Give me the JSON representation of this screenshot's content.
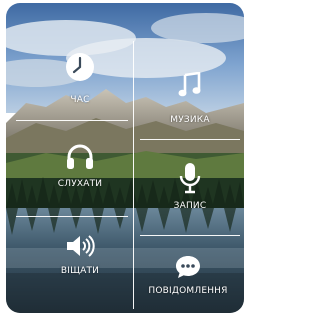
{
  "tiles": {
    "time": {
      "label": "ЧАС",
      "icon": "clock-icon"
    },
    "music": {
      "label": "МУЗИКА",
      "icon": "music-note-icon"
    },
    "listen": {
      "label": "СЛУХАТИ",
      "icon": "headphones-icon"
    },
    "record": {
      "label": "ЗАПИС",
      "icon": "microphone-icon"
    },
    "watch": {
      "label": "ВІЩАТИ",
      "icon": "speaker-icon"
    },
    "messages": {
      "label": "ПОВІДОМЛЕННЯ",
      "icon": "chat-bubble-icon"
    }
  },
  "colors": {
    "foreground": "#ffffff",
    "sky": "#5b85b8",
    "water": "#2d4a5e",
    "forest": "#1f3b22"
  }
}
